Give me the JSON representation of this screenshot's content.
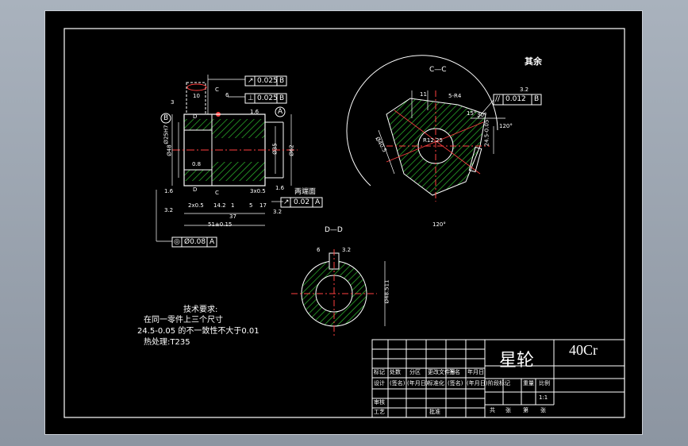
{
  "drawing": {
    "title": "星轮",
    "material": "40Cr",
    "scale": "1:1",
    "views": {
      "c_c": "C—C",
      "d_d": "D—D"
    },
    "roughness_other": "其余",
    "tech_requirements": {
      "heading": "技术要求:",
      "line1": "在同一零件上三个尺寸",
      "line2": "24.5-0.05 的不一致性不大于0.01",
      "line3": "热处理:T235"
    },
    "both_ends_label": "两端面",
    "tolerance_frames": [
      {
        "symbol": "↗",
        "value": "0.025",
        "datum": "B"
      },
      {
        "symbol": "⊥",
        "value": "0.025",
        "datum": "B"
      },
      {
        "symbol": "↗",
        "value": "0.02",
        "datum": "A"
      },
      {
        "symbol": "◎",
        "value": "Ø0.08",
        "datum": "A"
      },
      {
        "symbol": "//",
        "value": "0.012",
        "datum": "B"
      }
    ],
    "datums": [
      "B",
      "A"
    ],
    "section_marks": [
      "C",
      "C",
      "D",
      "D"
    ],
    "dimensions": {
      "d_3": "3",
      "d_10": "10",
      "d_6": "6",
      "d_1_6a": "1.6",
      "d_1_6b": "1.6",
      "d_1_6c": "1.6",
      "d_0_8": "0.8",
      "d_2x0_5": "2x0.5",
      "d_14_2": "14.2",
      "d_1": "1",
      "d_3x0_5": "3x0.5",
      "d_5": "5",
      "d_17": "17",
      "d_37": "37",
      "d_51": "51±0.15",
      "d_3_2a": "3.2",
      "d_3_2b": "3.2",
      "d_3_2c": "3.2",
      "d_25": "Ø25H7",
      "d_48": "Ø48",
      "d_35": "Ø35",
      "d_62": "Ø62",
      "d_r": "R12.25",
      "d_5pc": "5-R4",
      "d_15deg": "15°",
      "d_11": "11",
      "d_30": "30°",
      "d_24": "24.5-0.05",
      "d_120a": "120°",
      "d_120b": "120°",
      "d_40": "Ø40.5",
      "d_dd_6": "6",
      "d_dd_3_2": "3.2",
      "d_dd_48": "Ø48.511"
    }
  },
  "title_block": {
    "row_labels": {
      "marks": "标记",
      "count": "处数",
      "zone": "分区",
      "change_doc": "更改文件号",
      "sign": "签名",
      "date": "年月日",
      "design": "设计",
      "sign2": "(签名)",
      "date2": "(年月日)",
      "standardize": "标准化",
      "sign3": "(签名)",
      "date3": "(年月日)",
      "review": "审核",
      "process": "工艺",
      "approve": "批准"
    },
    "stage_mark": "阶段标记",
    "weight": "重量",
    "ratio": "比例",
    "sheet_total": "共",
    "sheet_unit": "张",
    "sheet_no": "第",
    "sheet_unit2": "张"
  }
}
